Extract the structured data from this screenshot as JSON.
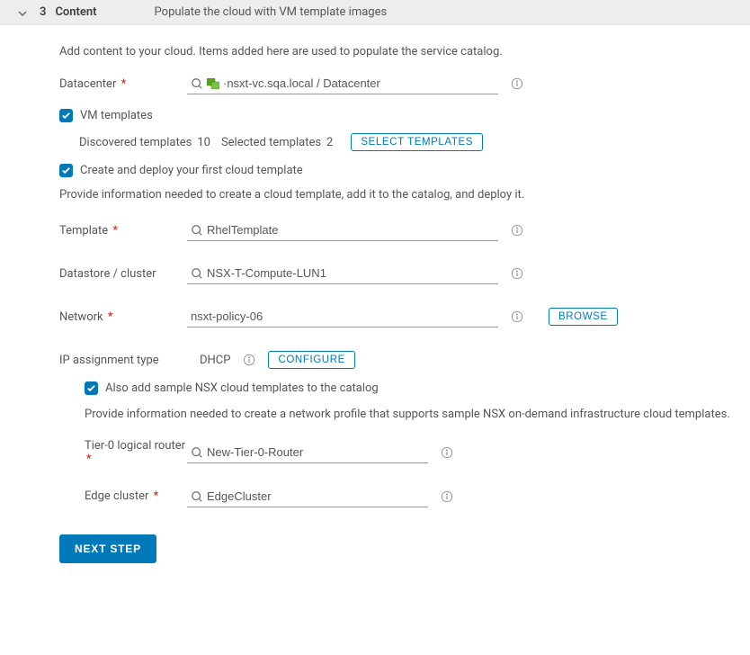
{
  "header": {
    "step_number": "3",
    "step_title": "Content",
    "step_description": "Populate the cloud with VM template images"
  },
  "intro": "Add content to your cloud. Items added here are used to populate the service catalog.",
  "datacenter": {
    "label": "Datacenter",
    "value": "·nsxt-vc.sqa.local / Datacenter"
  },
  "vm_templates": {
    "label": "VM templates",
    "discovered_label": "Discovered templates",
    "discovered_count": "10",
    "selected_label": "Selected templates",
    "selected_count": "2",
    "select_btn": "SELECT TEMPLATES"
  },
  "create_deploy": {
    "label": "Create and deploy your first cloud template",
    "intro": "Provide information needed to create a cloud template, add it to the catalog, and deploy it.",
    "template": {
      "label": "Template",
      "value": "RhelTemplate"
    },
    "datastore": {
      "label": "Datastore / cluster",
      "value": "NSX-T-Compute-LUN1"
    },
    "network": {
      "label": "Network",
      "value": "nsxt-policy-06",
      "browse_btn": "BROWSE"
    },
    "ip": {
      "label": "IP assignment type",
      "value": "DHCP",
      "configure_btn": "CONFIGURE"
    }
  },
  "nsx": {
    "label": "Also add sample NSX cloud templates to the catalog",
    "desc": "Provide information needed to create a network profile that supports sample NSX on-demand infrastructure cloud templates.",
    "tier0": {
      "label": "Tier-0 logical router",
      "value": "New-Tier-0-Router"
    },
    "edge": {
      "label": "Edge cluster",
      "value": "EdgeCluster"
    }
  },
  "footer": {
    "next_btn": "NEXT STEP"
  }
}
